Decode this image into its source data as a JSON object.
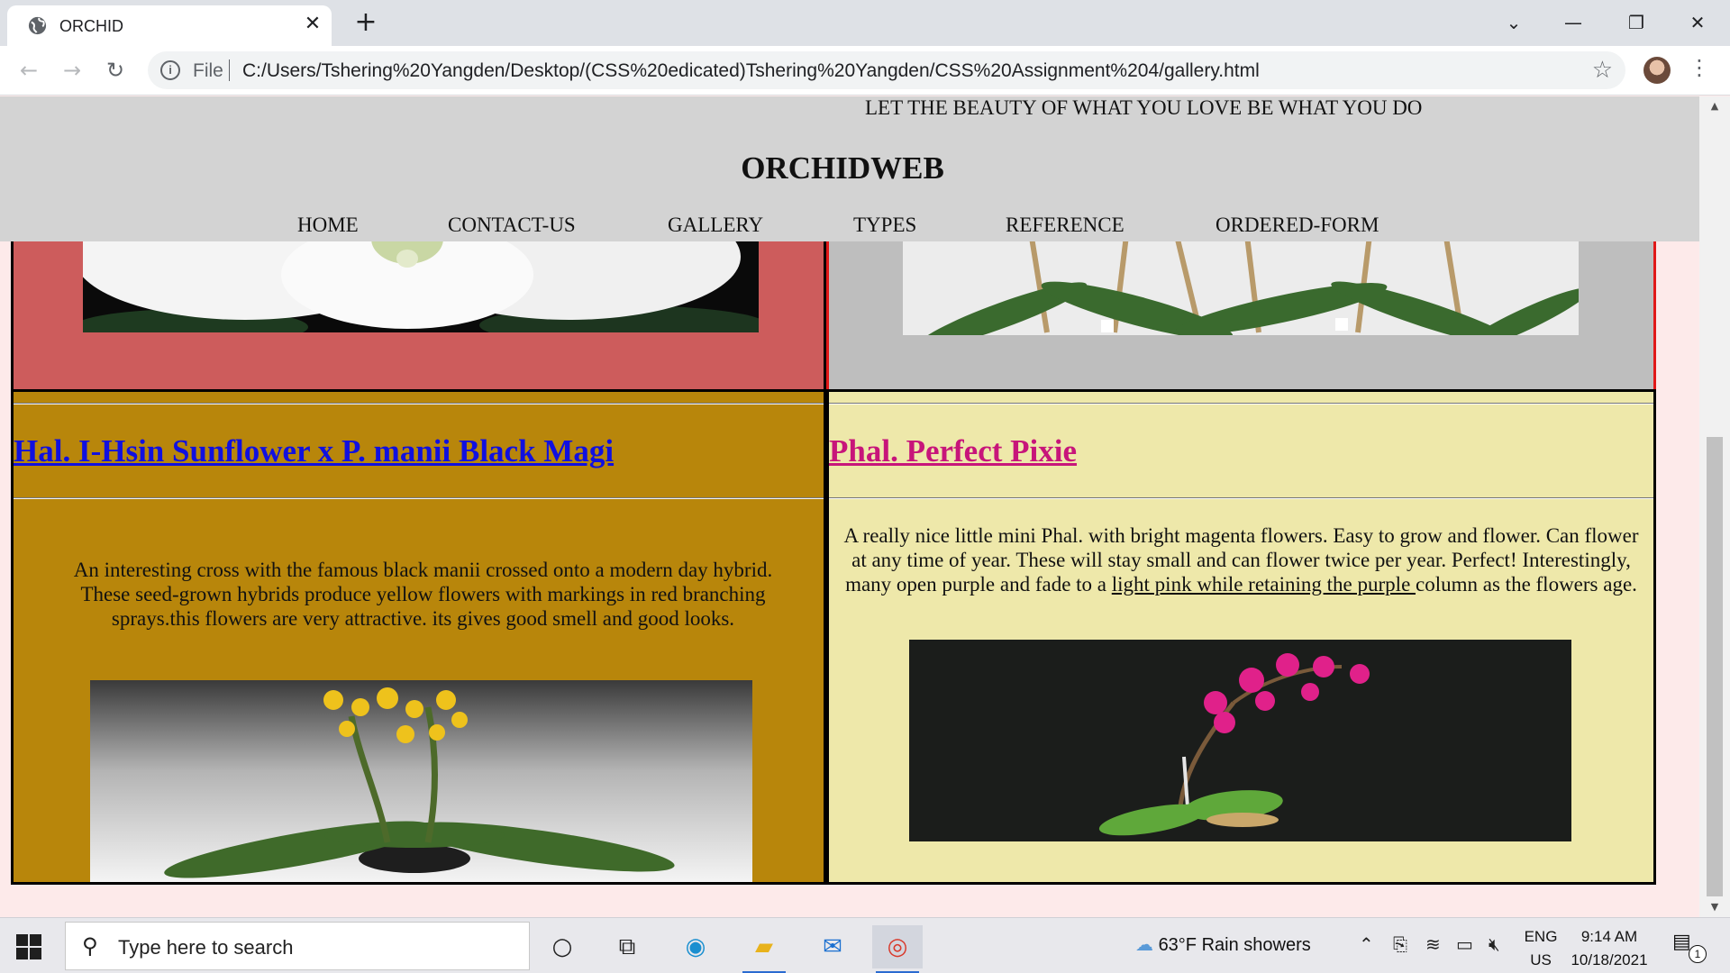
{
  "browser": {
    "tab_title": "ORCHID",
    "file_label": "File",
    "url": "C:/Users/Tshering%20Yangden/Desktop/(CSS%20edicated)Tshering%20Yangden/CSS%20Assignment%204/gallery.html",
    "icons": [
      "globe-icon",
      "close-icon",
      "plus-icon",
      "back-arrow-icon",
      "forward-arrow-icon",
      "reload-icon",
      "info-icon",
      "star-icon",
      "kebab-menu-icon"
    ]
  },
  "header": {
    "tagline": "LET THE BEAUTY OF WHAT YOU LOVE BE WHAT YOU DO",
    "logo": "ORCHIDWEB",
    "nav": [
      "HOME",
      "CONTACT-US",
      "GALLERY",
      "TYPES",
      "REFERENCE",
      "ORDERED-FORM"
    ],
    "background": "#d3d3d3"
  },
  "gallery": {
    "row1": {
      "left_bg": "#cd5c5c",
      "right_bg": "#bebebe",
      "right_border": "#e01818"
    },
    "item_left": {
      "title": "Hal. I-Hsin Sunflower x P. manii Black Magi",
      "title_color": "#1010e0",
      "text": "An interesting cross with the famous black manii crossed onto a modern day hybrid. These seed-grown hybrids produce yellow flowers with markings in red branching sprays.this flowers are very attractive. its gives good smell and good looks.",
      "background": "#b8860b"
    },
    "item_right": {
      "title": "Phal. Perfect Pixie",
      "title_color": "#c7157a",
      "text_before_link": "A really nice little mini Phal. with bright magenta flowers. Easy to grow and flower. Can flower at any time of year. These will stay small and can flower twice per year. Perfect! Interestingly, many open purple and fade to a ",
      "text_link": "light pink while retaining the purple ",
      "text_after_link": "column as the flowers age.",
      "background": "#eee8aa"
    }
  },
  "taskbar": {
    "search_placeholder": "Type here to search",
    "weather": "63°F  Rain showers",
    "lang_line1": "ENG",
    "lang_line2": "US",
    "time": "9:14 AM",
    "date": "10/18/2021",
    "notification_count": "1",
    "icons": [
      "windows-start-icon",
      "search-icon",
      "cortana-icon",
      "task-view-icon",
      "edge-icon",
      "file-explorer-icon",
      "mail-icon",
      "chrome-icon",
      "weather-icon",
      "chevron-up-icon",
      "meet-now-icon",
      "wifi-icon",
      "battery-icon",
      "volume-muted-icon",
      "notification-icon"
    ]
  }
}
